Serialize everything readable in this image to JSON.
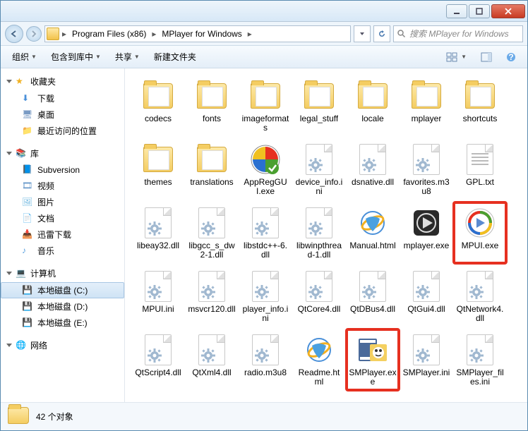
{
  "titlebar": {
    "min": "_",
    "max": "□",
    "close": "✕"
  },
  "breadcrumb": {
    "seg1": "Program Files (x86)",
    "seg2": "MPlayer for Windows"
  },
  "search": {
    "placeholder": "搜索 MPlayer for Windows"
  },
  "toolbar": {
    "organize": "组织",
    "include": "包含到库中",
    "share": "共享",
    "newfolder": "新建文件夹"
  },
  "sidebar": {
    "fav": {
      "hdr": "收藏夹",
      "dl": "下载",
      "dsk": "桌面",
      "rec": "最近访问的位置"
    },
    "lib": {
      "hdr": "库",
      "svn": "Subversion",
      "vid": "视频",
      "pic": "图片",
      "doc": "文档",
      "xl": "迅雷下载",
      "mus": "音乐"
    },
    "comp": {
      "hdr": "计算机",
      "c": "本地磁盘 (C:)",
      "d": "本地磁盘 (D:)",
      "e": "本地磁盘 (E:)"
    },
    "net": {
      "hdr": "网络"
    }
  },
  "items": [
    {
      "n": "codecs",
      "t": "folder"
    },
    {
      "n": "fonts",
      "t": "folder"
    },
    {
      "n": "imageformats",
      "t": "folder"
    },
    {
      "n": "legal_stuff",
      "t": "folder"
    },
    {
      "n": "locale",
      "t": "folder"
    },
    {
      "n": "mplayer",
      "t": "folder"
    },
    {
      "n": "shortcuts",
      "t": "folder"
    },
    {
      "n": "themes",
      "t": "folder"
    },
    {
      "n": "translations",
      "t": "folder"
    },
    {
      "n": "AppRegGUI.exe",
      "t": "appreg"
    },
    {
      "n": "device_info.ini",
      "t": "ini"
    },
    {
      "n": "dsnative.dll",
      "t": "dll"
    },
    {
      "n": "favorites.m3u8",
      "t": "dll"
    },
    {
      "n": "GPL.txt",
      "t": "txt"
    },
    {
      "n": "libeay32.dll",
      "t": "dll"
    },
    {
      "n": "libgcc_s_dw2-1.dll",
      "t": "dll"
    },
    {
      "n": "libstdc++-6.dll",
      "t": "dll"
    },
    {
      "n": "libwinpthread-1.dll",
      "t": "dll"
    },
    {
      "n": "Manual.html",
      "t": "html"
    },
    {
      "n": "mplayer.exe",
      "t": "mplayer"
    },
    {
      "n": "MPUI.exe",
      "t": "mpui",
      "hl": true
    },
    {
      "n": "MPUI.ini",
      "t": "ini"
    },
    {
      "n": "msvcr120.dll",
      "t": "dll"
    },
    {
      "n": "player_info.ini",
      "t": "ini"
    },
    {
      "n": "QtCore4.dll",
      "t": "dll"
    },
    {
      "n": "QtDBus4.dll",
      "t": "dll"
    },
    {
      "n": "QtGui4.dll",
      "t": "dll"
    },
    {
      "n": "QtNetwork4.dll",
      "t": "dll"
    },
    {
      "n": "QtScript4.dll",
      "t": "dll"
    },
    {
      "n": "QtXml4.dll",
      "t": "dll"
    },
    {
      "n": "radio.m3u8",
      "t": "dll"
    },
    {
      "n": "Readme.html",
      "t": "html"
    },
    {
      "n": "SMPlayer.exe",
      "t": "smplayer",
      "hl": true
    },
    {
      "n": "SMPlayer.ini",
      "t": "ini"
    },
    {
      "n": "SMPlayer_files.ini",
      "t": "ini"
    }
  ],
  "status": {
    "count": "42 个对象"
  }
}
